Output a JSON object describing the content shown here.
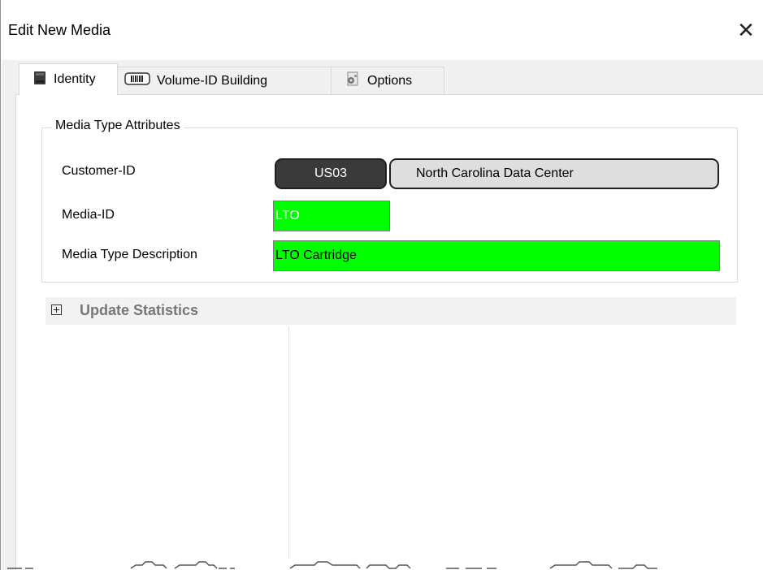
{
  "window": {
    "title": "Edit New Media",
    "close_glyph": "✕"
  },
  "tabs": [
    {
      "label": "Identity",
      "icon": "tape-cartridge-icon",
      "active": true
    },
    {
      "label": "Volume-ID Building",
      "icon": "barcode-icon",
      "active": false
    },
    {
      "label": "Options",
      "icon": "options-gear-icon",
      "active": false
    }
  ],
  "media_type_attributes": {
    "legend": "Media Type Attributes",
    "customer_id": {
      "label": "Customer-ID",
      "code": "US03",
      "name": "North Carolina Data Center"
    },
    "media_id": {
      "label": "Media-ID",
      "value": "LTO"
    },
    "media_type_description": {
      "label": "Media Type Description",
      "value": "LTO Cartridge"
    }
  },
  "update_statistics": {
    "label": "Update Statistics",
    "expanded": false
  },
  "colors": {
    "required_field_bg": "#00ff00",
    "dark_pill_bg": "#3a3a3a",
    "light_pill_bg": "#dedede",
    "section_header_text": "#777777"
  }
}
